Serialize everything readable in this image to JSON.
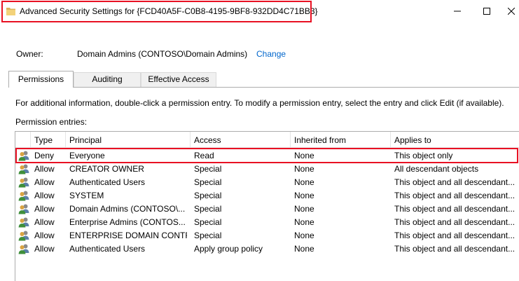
{
  "window": {
    "title": "Advanced Security Settings for {FCD40A5F-C0B8-4195-9BF8-932DD4C71BB3}",
    "highlight_color": "#e81123"
  },
  "owner": {
    "label": "Owner:",
    "value": "Domain Admins (CONTOSO\\Domain Admins)",
    "change_link": "Change"
  },
  "tabs": [
    {
      "label": "Permissions",
      "active": true
    },
    {
      "label": "Auditing",
      "active": false
    },
    {
      "label": "Effective Access",
      "active": false
    }
  ],
  "info_text": "For additional information, double-click a permission entry. To modify a permission entry, select the entry and click Edit (if available).",
  "entries_label": "Permission entries:",
  "columns": [
    "Type",
    "Principal",
    "Access",
    "Inherited from",
    "Applies to"
  ],
  "entries": [
    {
      "type": "Deny",
      "principal": "Everyone",
      "access": "Read",
      "inherited": "None",
      "applies": "This object only"
    },
    {
      "type": "Allow",
      "principal": "CREATOR OWNER",
      "access": "Special",
      "inherited": "None",
      "applies": "All descendant objects"
    },
    {
      "type": "Allow",
      "principal": "Authenticated Users",
      "access": "Special",
      "inherited": "None",
      "applies": "This object and all descendant..."
    },
    {
      "type": "Allow",
      "principal": "SYSTEM",
      "access": "Special",
      "inherited": "None",
      "applies": "This object and all descendant..."
    },
    {
      "type": "Allow",
      "principal": "Domain Admins (CONTOSO\\...",
      "access": "Special",
      "inherited": "None",
      "applies": "This object and all descendant..."
    },
    {
      "type": "Allow",
      "principal": "Enterprise Admins (CONTOS...",
      "access": "Special",
      "inherited": "None",
      "applies": "This object and all descendant..."
    },
    {
      "type": "Allow",
      "principal": "ENTERPRISE DOMAIN CONTR...",
      "access": "Special",
      "inherited": "None",
      "applies": "This object and all descendant..."
    },
    {
      "type": "Allow",
      "principal": "Authenticated Users",
      "access": "Apply group policy",
      "inherited": "None",
      "applies": "This object and all descendant..."
    }
  ]
}
